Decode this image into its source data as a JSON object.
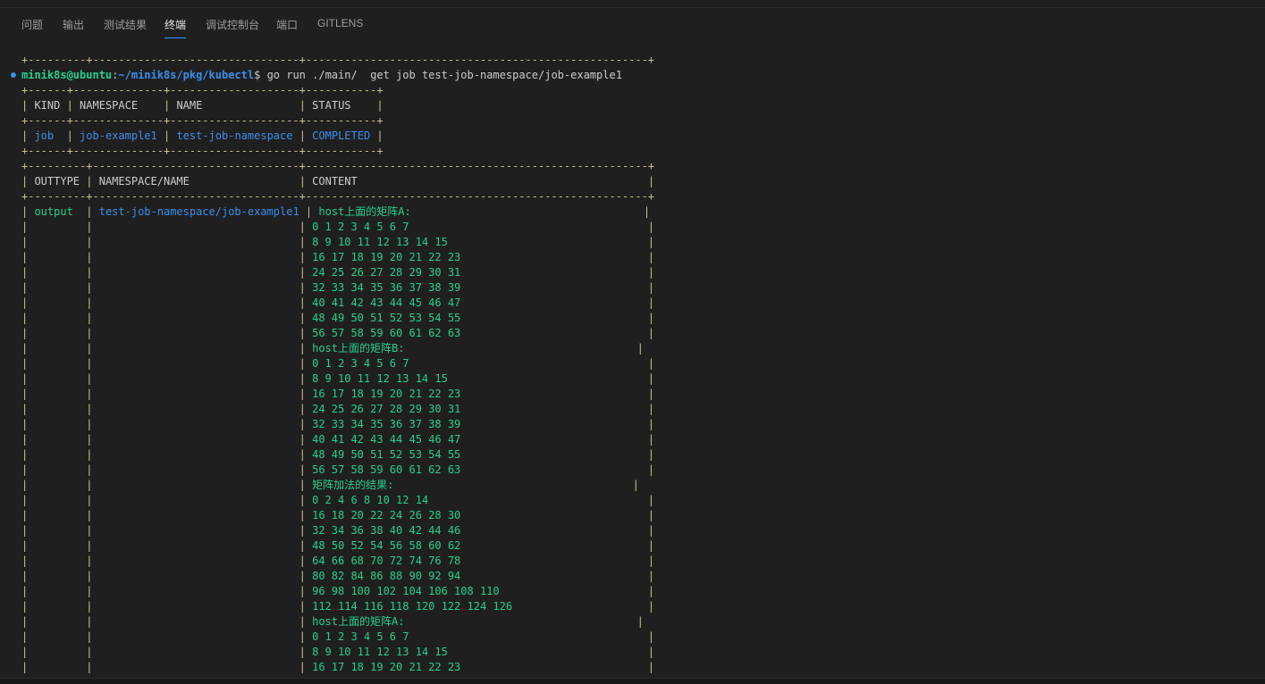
{
  "tabs": [
    {
      "label": "问题"
    },
    {
      "label": "输出"
    },
    {
      "label": "测试结果"
    },
    {
      "label": "终端"
    },
    {
      "label": "调试控制台"
    },
    {
      "label": "端口"
    },
    {
      "label": "GITLENS"
    }
  ],
  "prompt": {
    "user": "minik8s@ubuntu",
    "path": "~/minik8s/pkg/kubectl",
    "command": "go run ./main/  get job test-job-namespace/job-example1"
  },
  "job_table": {
    "headers": [
      "KIND",
      "NAMESPACE",
      "NAME",
      "STATUS"
    ],
    "row": [
      "job",
      "job-example1",
      "test-job-namespace",
      "COMPLETED"
    ]
  },
  "output_table": {
    "headers": [
      "OUTTYPE",
      "NAMESPACE/NAME",
      "CONTENT"
    ],
    "outtype": "output",
    "name": "test-job-namespace/job-example1",
    "content": [
      "host上面的矩阵A:",
      "0 1 2 3 4 5 6 7",
      "8 9 10 11 12 13 14 15",
      "16 17 18 19 20 21 22 23",
      "24 25 26 27 28 29 30 31",
      "32 33 34 35 36 37 38 39",
      "40 41 42 43 44 45 46 47",
      "48 49 50 51 52 53 54 55",
      "56 57 58 59 60 61 62 63",
      "host上面的矩阵B:",
      "0 1 2 3 4 5 6 7",
      "8 9 10 11 12 13 14 15",
      "16 17 18 19 20 21 22 23",
      "24 25 26 27 28 29 30 31",
      "32 33 34 35 36 37 38 39",
      "40 41 42 43 44 45 46 47",
      "48 49 50 51 52 53 54 55",
      "56 57 58 59 60 61 62 63",
      "矩阵加法的结果:",
      "0 2 4 6 8 10 12 14",
      "16 18 20 22 24 26 28 30",
      "32 34 36 38 40 42 44 46",
      "48 50 52 54 56 58 60 62",
      "64 66 68 70 72 74 76 78",
      "80 82 84 86 88 90 92 94",
      "96 98 100 102 104 106 108 110",
      "112 114 116 118 120 122 124 126",
      "host上面的矩阵A:",
      "0 1 2 3 4 5 6 7",
      "8 9 10 11 12 13 14 15",
      "16 17 18 19 20 21 22 23"
    ]
  }
}
